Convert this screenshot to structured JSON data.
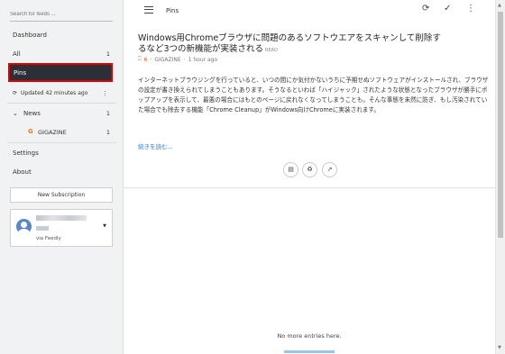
{
  "sidebar": {
    "search_placeholder": "Search for feeds ...",
    "dashboard": "Dashboard",
    "all": {
      "label": "All",
      "count": "1"
    },
    "pins": "Pins",
    "updated": "Updated 42 minutes ago",
    "news": {
      "label": "News",
      "count": "1"
    },
    "gigazine": {
      "icon": "G",
      "label": "GIGAZINE",
      "count": "1"
    },
    "settings": "Settings",
    "about": "About",
    "new_subscription": "New Subscription",
    "account": {
      "via": "via Feedly"
    }
  },
  "topbar": {
    "title": "Pins"
  },
  "article": {
    "title": "Windows用Chromeブラウザに問題のあるソフトウエアをスキャンして削除するなど3つの新機能が実装される",
    "badge": "READ",
    "pin_count": "6",
    "source": "GIGAZINE",
    "time": "1 hour ago",
    "body": "インターネットブラウジングを行っていると、いつの間にか気付かないうちに予期せぬソフトウェアがインストールされ、ブラウザの設定が書き換えられてしまうこともあります。そうなるといわば「ハイジャック」されたような状態となったブラウザが勝手にポップアップを表示して、最悪の場合にはもとのページに戻れなくなってしまうことも。そんな事態を未然に防ぎ、もし汚染されていた場合でも除去する機能「Chrome Cleanup」がWindows向けChromeに実装されます。",
    "read_more": "続きを読む..."
  },
  "footer": {
    "no_more": "No more entries here."
  },
  "colors": {
    "sidebar_bg": "#f1f2f3",
    "selected_bg": "#2b2f36",
    "highlight": "#e00000",
    "link": "#2a7bd4",
    "gigazine": "#e67e22"
  }
}
